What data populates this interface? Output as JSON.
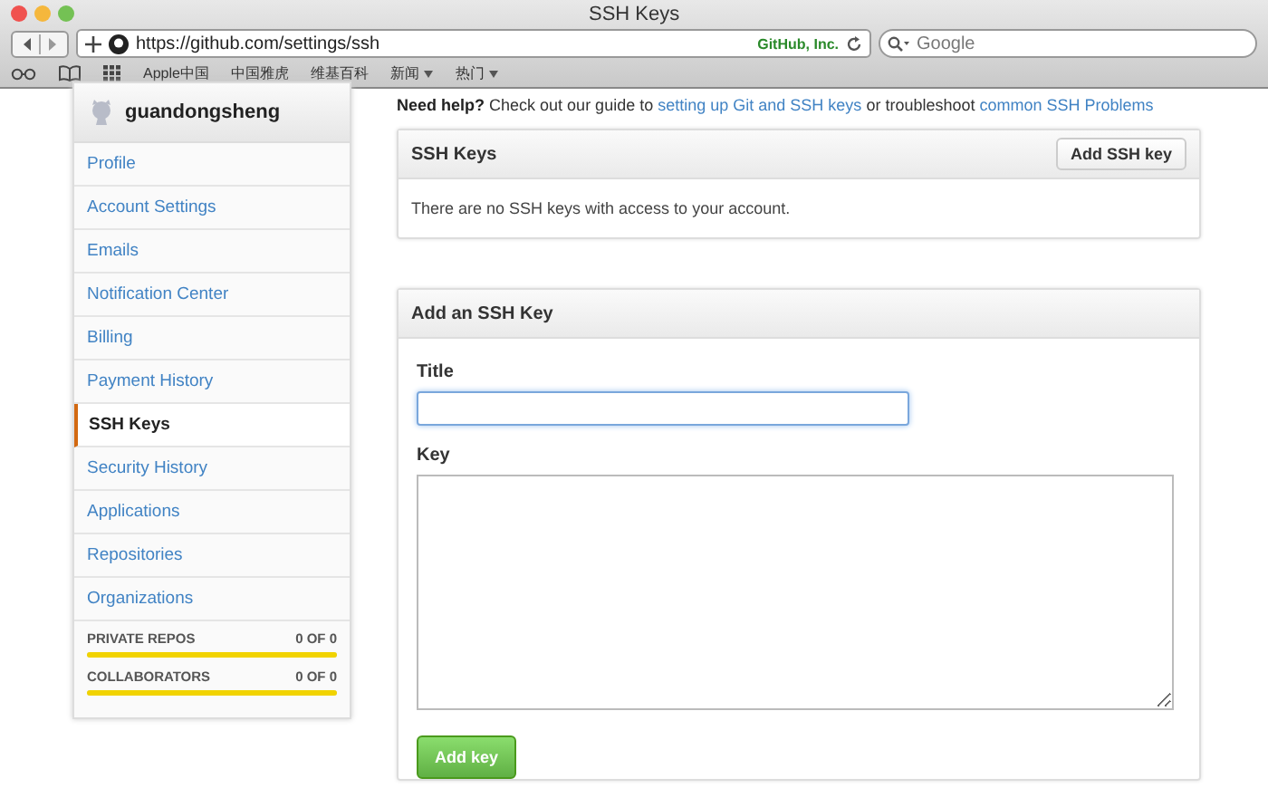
{
  "window": {
    "title": "SSH Keys"
  },
  "toolbar": {
    "url": "https://github.com/settings/ssh",
    "site_identity": "GitHub, Inc.",
    "search": {
      "placeholder": "Google"
    }
  },
  "bookmarks": [
    "Apple中国",
    "中国雅虎",
    "维基百科",
    {
      "label": "新闻",
      "menu": true
    },
    {
      "label": "热门",
      "menu": true
    }
  ],
  "sidebar": {
    "username": "guandongsheng",
    "items": [
      {
        "label": "Profile",
        "selected": false
      },
      {
        "label": "Account Settings",
        "selected": false
      },
      {
        "label": "Emails",
        "selected": false
      },
      {
        "label": "Notification Center",
        "selected": false
      },
      {
        "label": "Billing",
        "selected": false
      },
      {
        "label": "Payment History",
        "selected": false
      },
      {
        "label": "SSH Keys",
        "selected": true
      },
      {
        "label": "Security History",
        "selected": false
      },
      {
        "label": "Applications",
        "selected": false
      },
      {
        "label": "Repositories",
        "selected": false
      },
      {
        "label": "Organizations",
        "selected": false
      }
    ],
    "usage": [
      {
        "label": "PRIVATE REPOS",
        "reading": "0 OF 0",
        "level": 1
      },
      {
        "label": "COLLABORATORS",
        "reading": "0 OF 0",
        "level": 1
      }
    ]
  },
  "help": {
    "lead": "Need help?",
    "text_1": "Check out our guide to",
    "link_1": "setting up Git and SSH keys",
    "text_2": "or troubleshoot",
    "link_2": "common SSH Problems"
  },
  "ssh_keys": {
    "title": "SSH Keys",
    "button": "Add SSH key",
    "empty_message": "There are no SSH keys with access to your account."
  },
  "add_key": {
    "title": "Add an SSH Key",
    "title_label": "Title",
    "key_label": "Key",
    "button": "Add key"
  }
}
